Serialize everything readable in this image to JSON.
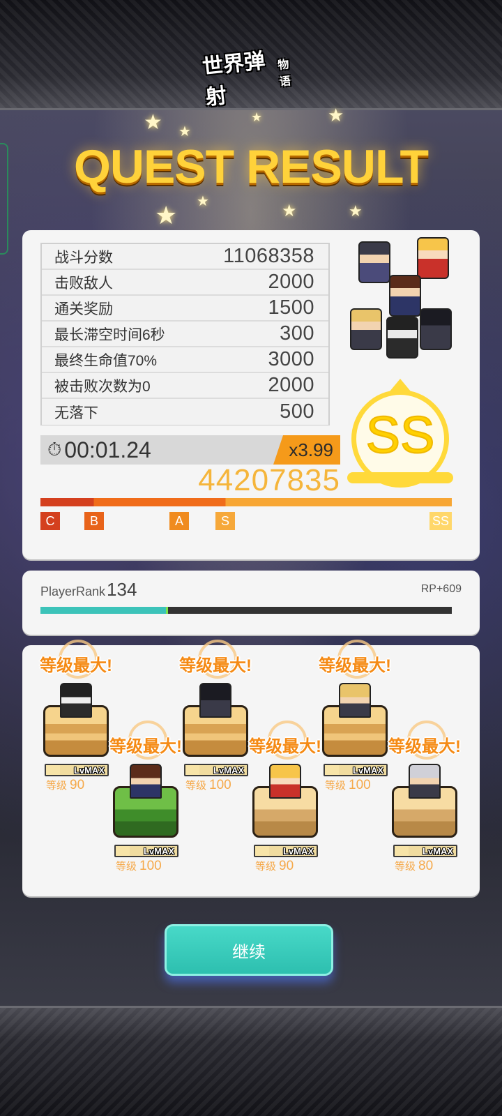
{
  "logo": {
    "main": "世界弹射",
    "sub": "物语"
  },
  "title": "QUEST RESULT",
  "stats": [
    {
      "label": "战斗分数",
      "value": "11068358"
    },
    {
      "label": "击败敌人",
      "value": "2000"
    },
    {
      "label": "通关奖励",
      "value": "1500"
    },
    {
      "label": "最长滞空时间6秒",
      "value": "300"
    },
    {
      "label": "最终生命值70%",
      "value": "3000"
    },
    {
      "label": "被击败次数为0",
      "value": "2000"
    },
    {
      "label": "无落下",
      "value": "500"
    }
  ],
  "clear_time": "00:01.24",
  "time_icon": "stopwatch-icon",
  "multiplier": "x3.99",
  "total_score": "44207835",
  "rank": "SS",
  "grades": [
    "C",
    "B",
    "A",
    "S",
    "SS"
  ],
  "grade_progress": 1.0,
  "player": {
    "rank_label": "PlayerRank",
    "rank_value": "134",
    "rp_gain": "RP+609",
    "rank_progress": 0.31
  },
  "units": [
    {
      "badge_a": "等级",
      "badge_b": "最大!",
      "lvmax": "LvMAX",
      "level_label": "等级",
      "level": "90"
    },
    {
      "badge_a": "等级",
      "badge_b": "最大!",
      "lvmax": "LvMAX",
      "level_label": "等级",
      "level": "100"
    },
    {
      "badge_a": "等级",
      "badge_b": "最大!",
      "lvmax": "LvMAX",
      "level_label": "等级",
      "level": "100"
    },
    {
      "badge_a": "等级",
      "badge_b": "最大!",
      "lvmax": "LvMAX",
      "level_label": "等级",
      "level": "90"
    },
    {
      "badge_a": "等级",
      "badge_b": "最大!",
      "lvmax": "LvMAX",
      "level_label": "等级",
      "level": "100"
    },
    {
      "badge_a": "等级",
      "badge_b": "最大!",
      "lvmax": "LvMAX",
      "level_label": "等级",
      "level": "80"
    }
  ],
  "continue_label": "继续",
  "colors": {
    "accent_orange": "#f59a1a",
    "score_gold": "#f5b53b",
    "rank_yellow": "#ffd93a",
    "teal": "#2dbfaf"
  }
}
